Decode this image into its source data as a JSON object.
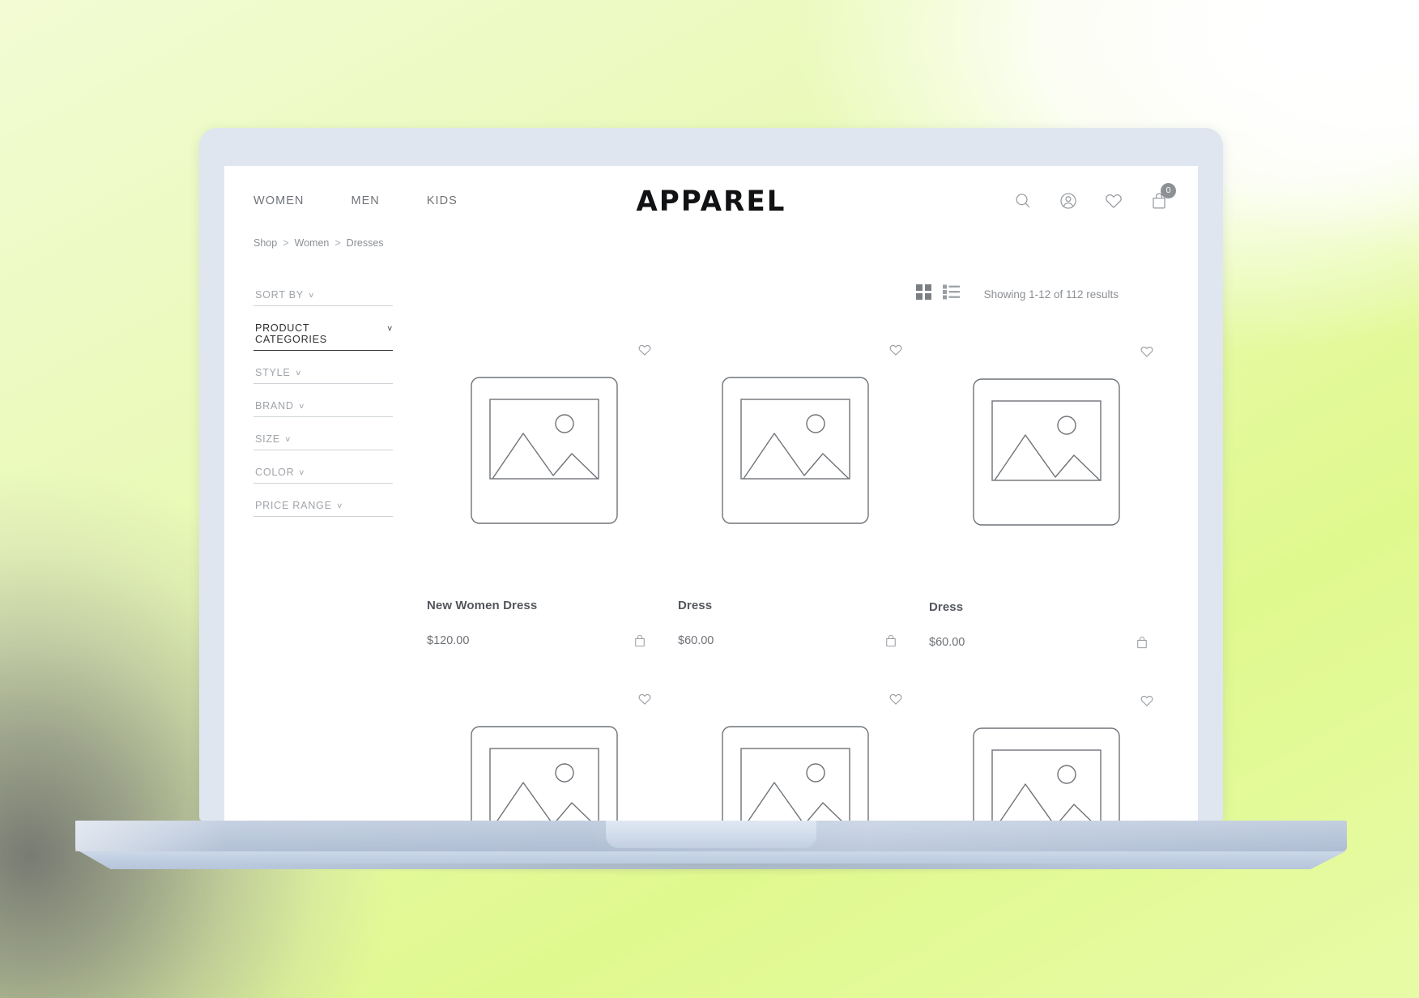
{
  "brand": {
    "name": "APPAREL"
  },
  "nav": {
    "items": [
      {
        "label": "WOMEN",
        "name": "nav-women"
      },
      {
        "label": "MEN",
        "name": "nav-men"
      },
      {
        "label": "KIDS",
        "name": "nav-kids"
      }
    ]
  },
  "header_icons": {
    "search": "search-icon",
    "account": "user-account-icon",
    "wishlist": "heart-icon",
    "cart": "shopping-bag-icon",
    "cart_count": "0"
  },
  "breadcrumb": {
    "items": [
      "Shop",
      "Women",
      "Dresses"
    ],
    "separator": ">"
  },
  "sidebar": {
    "filters": [
      {
        "label": "SORT BY",
        "active": false
      },
      {
        "label": "PRODUCT CATEGORIES",
        "active": true
      },
      {
        "label": "STYLE",
        "active": false
      },
      {
        "label": "BRAND",
        "active": false
      },
      {
        "label": "SIZE",
        "active": false
      },
      {
        "label": "COLOR",
        "active": false
      },
      {
        "label": "PRICE RANGE",
        "active": false
      }
    ],
    "chevron": "∨"
  },
  "toolbar": {
    "grid_view_icon": "grid-view-icon",
    "list_view_icon": "list-view-icon",
    "results_text": "Showing 1-12 of 112 results"
  },
  "products": {
    "row1": [
      {
        "title": "New Women Dress",
        "price": "$120.00"
      },
      {
        "title": "Dress",
        "price": "$60.00"
      },
      {
        "title": "Dress",
        "price": "$60.00"
      }
    ],
    "row2": [
      {
        "title": "",
        "price": ""
      },
      {
        "title": "",
        "price": ""
      },
      {
        "title": "",
        "price": ""
      }
    ]
  },
  "colors": {
    "background_green": "#e9fab4",
    "laptop_bezel": "#dfe6f0",
    "laptop_base": "#b8c6da",
    "text_muted": "#8b8f94",
    "text_dark": "#2d2f32",
    "icon_gray": "#9a9ea3"
  }
}
